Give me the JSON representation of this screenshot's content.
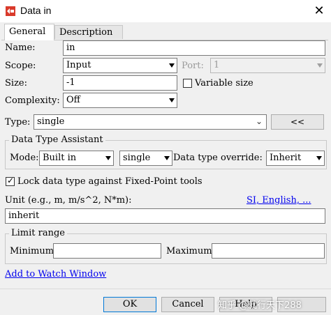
{
  "window": {
    "title": "Data in",
    "close_glyph": "✕"
  },
  "tabs": [
    {
      "label": "General",
      "active": true
    },
    {
      "label": "Description",
      "active": false
    }
  ],
  "name": {
    "label": "Name:",
    "value": "in"
  },
  "scope": {
    "label": "Scope:",
    "value": "Input"
  },
  "port": {
    "label": "Port:",
    "value": "1"
  },
  "size": {
    "label": "Size:",
    "value": "-1"
  },
  "variable_size": {
    "label": "Variable size",
    "checked": false
  },
  "complexity": {
    "label": "Complexity:",
    "value": "Off"
  },
  "type": {
    "label": "Type:",
    "value": "single",
    "collapse_label": "<<"
  },
  "assistant": {
    "title": "Data Type Assistant",
    "mode_label": "Mode:",
    "mode_value": "Built in",
    "builtin_value": "single",
    "override_label": "Data type override:",
    "override_value": "Inherit"
  },
  "lock": {
    "label": "Lock data type against Fixed-Point tools",
    "checked": true
  },
  "unit": {
    "label": "Unit (e.g., m, m/s^2, N*m):",
    "link": "SI, English, ...",
    "value": "inherit"
  },
  "limit": {
    "title": "Limit range",
    "min_label": "Minimum:",
    "min_value": "",
    "max_label": "Maximum:",
    "max_value": ""
  },
  "watch_link": "Add to Watch Window",
  "buttons": {
    "ok": "OK",
    "cancel": "Cancel",
    "help": "Help"
  },
  "watermark": "知乎 @就行天下288",
  "colors": {
    "accent": "#0078d7",
    "link": "#0000ee",
    "icon_red": "#d93a2b"
  }
}
